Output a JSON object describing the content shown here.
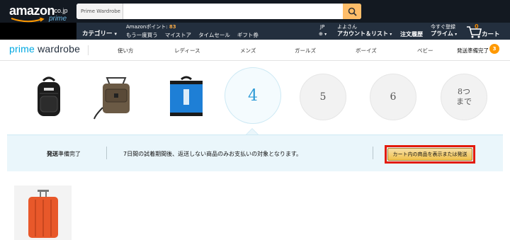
{
  "header": {
    "logo_text": "amazon",
    "logo_tld": ".co.jp",
    "logo_prime": "prime",
    "search_category": "Prime Wardrobe",
    "search_placeholder": "",
    "categories_label": "カテゴリー",
    "points_label": "Amazonポイント:",
    "points_value": "83",
    "links": [
      "もう一度買う",
      "マイストア",
      "タイムセール",
      "ギフト券"
    ],
    "lang_code": "JP",
    "greeting": "よよさん",
    "account_label": "アカウント＆リスト",
    "orders_label": "注文履歴",
    "prime_small": "今すぐ登録",
    "prime_label": "プライム",
    "cart_count": "0",
    "cart_label": "カート",
    "colors": {
      "header_bg": "#232f3e",
      "top_bg": "#131921",
      "search_btn": "#febd69",
      "accent": "#ff9900"
    }
  },
  "wardrobe_nav": {
    "brand_prime": "prime",
    "brand_wardrobe": "wardrobe",
    "items": [
      "使い方",
      "レディース",
      "メンズ",
      "ガールズ",
      "ボーイズ",
      "ベビー"
    ],
    "ready_label": "発送準備完了",
    "ready_count": "3"
  },
  "slots": {
    "products": [
      {
        "name": "black-backpack",
        "color": "#1c1c1c"
      },
      {
        "name": "brown-shoulder-bag",
        "color": "#6b5a45"
      },
      {
        "name": "blue-north-face-backpack",
        "color": "#1e7fd6"
      }
    ],
    "circles": [
      "4",
      "5",
      "6"
    ],
    "more_line1": "8つ",
    "more_line2": "まで"
  },
  "status_bar": {
    "ready_bold": "発送",
    "ready_rest": "準備完了",
    "message": "7日間の試着期間後、返送しない商品のみお支払いの対象となります。",
    "cta_label": "カート内の商品を表示または発送"
  },
  "thumbnails": [
    {
      "name": "orange-suitcase",
      "color": "#e8582a"
    }
  ]
}
